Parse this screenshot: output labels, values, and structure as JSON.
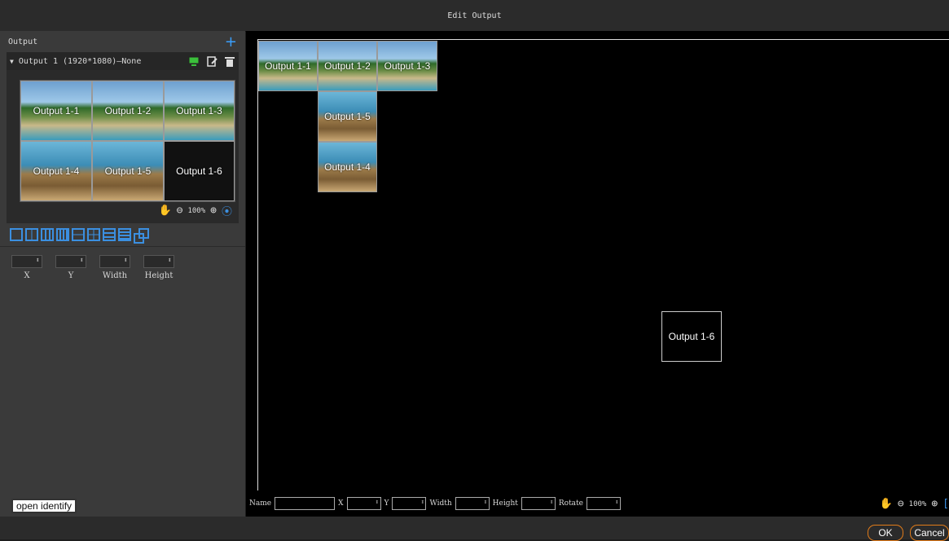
{
  "window": {
    "title": "Edit Output"
  },
  "left_panel": {
    "header_label": "Output",
    "output_row_label": "Output 1 (1920*1080)—None",
    "preview_zoom": "100%",
    "tiles": [
      {
        "label": "Output 1-1"
      },
      {
        "label": "Output 1-2"
      },
      {
        "label": "Output 1-3"
      },
      {
        "label": "Output 1-4"
      },
      {
        "label": "Output 1-5"
      },
      {
        "label": "Output 1-6"
      }
    ],
    "fields": {
      "x_label": "X",
      "y_label": "Y",
      "width_label": "Width",
      "height_label": "Height"
    },
    "identify_button": "open identify"
  },
  "canvas": {
    "tiles": [
      {
        "label": "Output 1-1"
      },
      {
        "label": "Output 1-2"
      },
      {
        "label": "Output 1-3"
      },
      {
        "label": "Output 1-5"
      },
      {
        "label": "Output 1-4"
      },
      {
        "label": "Output 1-6"
      }
    ],
    "bottom_fields": {
      "name": "Name",
      "x": "X",
      "y": "Y",
      "width": "Width",
      "height": "Height",
      "rotate": "Rotate"
    },
    "zoom": "100%"
  },
  "footer": {
    "ok": "OK",
    "cancel": "Cancel"
  },
  "colors": {
    "accent": "#3b8fe0",
    "button_border": "#e07b1a",
    "icon_green": "#3bbf3b"
  },
  "icons": [
    "plus-icon",
    "monitor-icon",
    "edit-icon",
    "trash-icon",
    "hand-icon",
    "zoom-out-icon",
    "zoom-in-icon",
    "fit-icon"
  ]
}
